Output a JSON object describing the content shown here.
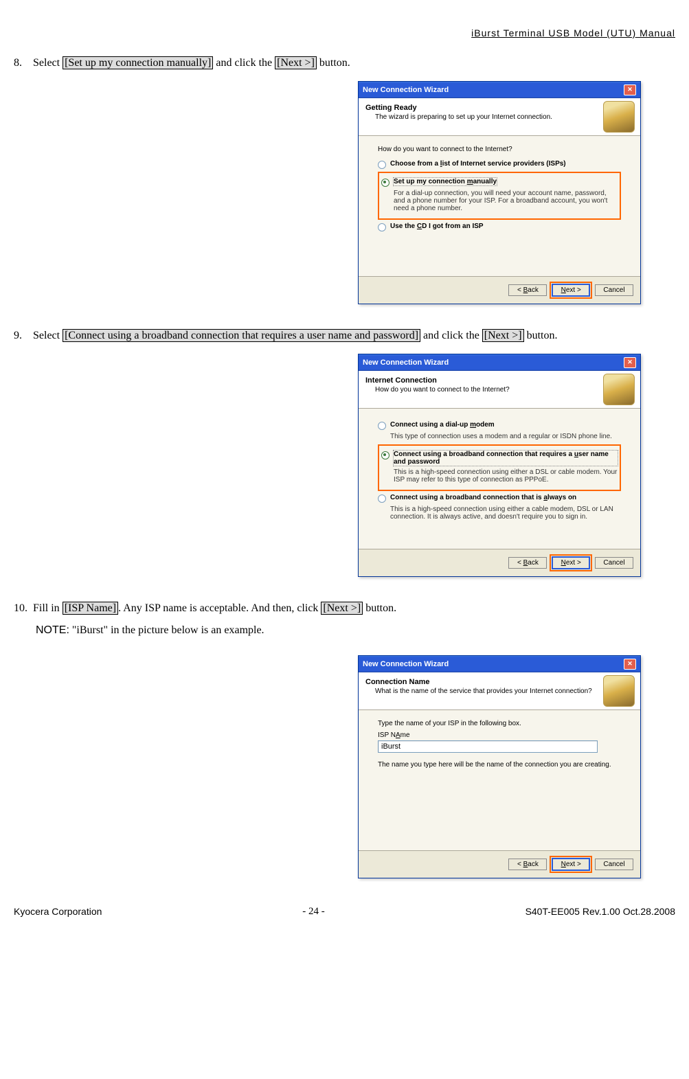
{
  "page_header": "iBurst  Terminal  USB  Model  (UTU)  Manual",
  "step8": {
    "num": "8.",
    "before1": "Select ",
    "hl1": "[Set up my connection manually]",
    "mid1": " and click the ",
    "hl2": "[Next >]",
    "after1": " button."
  },
  "step9": {
    "num": "9.",
    "before1": "Select  ",
    "hl1": "[Connect using a broadband connection that requires a user name and password]",
    "mid1": " and click the ",
    "hl2": "[Next >]",
    "after1": " button."
  },
  "step10": {
    "num": "10.",
    "before1": "Fill in ",
    "hl1": "[ISP Name]",
    "mid1": ".   Any ISP name is acceptable.   And then, click ",
    "hl2": "[Next >]",
    "after1": " button.",
    "note_label": "NOTE:",
    "note_text": "  \"iBurst\" in the picture below is an example."
  },
  "wiz": {
    "title": "New Connection Wizard",
    "back": "< Back",
    "next": "Next >",
    "cancel": "Cancel",
    "back_u": "B",
    "next_u": "N"
  },
  "wiz1": {
    "title": "Getting Ready",
    "sub": "The wizard is preparing to set up your Internet connection.",
    "question": "How do you want to connect to the Internet?",
    "opt1_before": "Choose from a ",
    "opt1_u": "l",
    "opt1_after": "ist of Internet service providers (ISPs)",
    "opt2_before": "Set up my connection ",
    "opt2_u": "m",
    "opt2_after": "anually",
    "opt2_desc": "For a dial-up connection, you will need your account name, password, and a phone number for your ISP. For a broadband account, you won't need a phone number.",
    "opt3_before": "Use the ",
    "opt3_u": "C",
    "opt3_after": "D I got from an ISP"
  },
  "wiz2": {
    "title": "Internet Connection",
    "sub": "How do you want to connect to the Internet?",
    "opt1_before": "Connect using a dial-up ",
    "opt1_u": "m",
    "opt1_after": "odem",
    "opt1_desc": "This type of connection uses a modem and a regular or ISDN phone line.",
    "opt2_before": "Connect using a broadband connection that requires a ",
    "opt2_u": "u",
    "opt2_after": "ser name and password",
    "opt2_desc": "This is a high-speed connection using either a DSL or cable modem. Your ISP may refer to this type of connection as PPPoE.",
    "opt3_before": "Connect using a broadband connection that is ",
    "opt3_u": "a",
    "opt3_after": "lways on",
    "opt3_desc": "This is a high-speed connection using either a cable modem, DSL or LAN connection. It is always active, and doesn't require you to sign in."
  },
  "wiz3": {
    "title": "Connection Name",
    "sub": "What is the name of the service that provides your Internet connection?",
    "prompt": "Type the name of your ISP in the following box.",
    "label": "ISP Name",
    "label_u": "A",
    "value": "iBurst",
    "note": "The name you type here will be the name of the connection you are creating."
  },
  "footer": {
    "left": "Kyocera Corporation",
    "center": "- 24 -",
    "right": "S40T-EE005 Rev.1.00 Oct.28.2008"
  }
}
